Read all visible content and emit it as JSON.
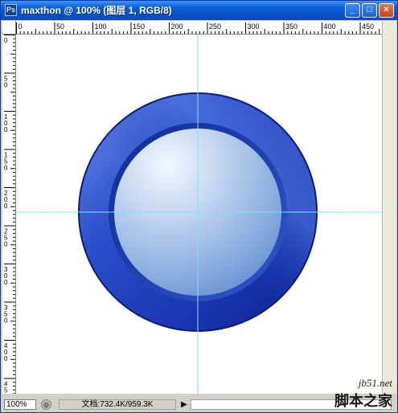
{
  "window": {
    "title": "maxthon @ 100% (图层 1, RGB/8)",
    "app_icon_text": "Ps"
  },
  "ruler": {
    "horizontal_ticks": [
      "0",
      "50",
      "100",
      "150",
      "200",
      "250",
      "300",
      "350",
      "400",
      "450"
    ],
    "vertical_ticks": [
      "0",
      "50",
      "100",
      "150",
      "200",
      "250",
      "300",
      "350",
      "400",
      "450"
    ]
  },
  "status": {
    "zoom": "100%",
    "doc_info": "文档:732.4K/959.3K"
  },
  "watermark": {
    "line1": "jb51.net",
    "line2": "脚本之家"
  },
  "colors": {
    "guide": "#7fe3f2",
    "ring_dark": "#0b1f8a",
    "ring_light": "#4f77e0",
    "inner_light": "#e9f0fb",
    "inner_mid": "#9ebbe6"
  }
}
